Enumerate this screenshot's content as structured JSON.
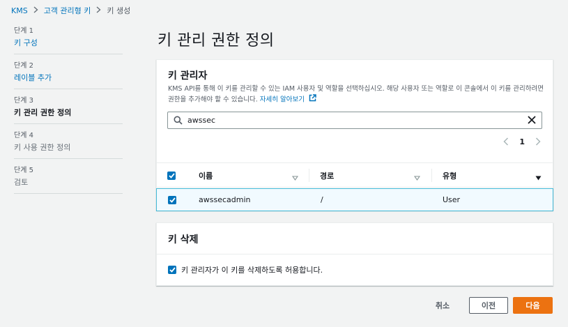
{
  "breadcrumb": {
    "items": [
      "KMS",
      "고객 관리형 키"
    ],
    "current": "키 생성"
  },
  "steps": [
    {
      "num": "단계 1",
      "label": "키 구성",
      "state": "link"
    },
    {
      "num": "단계 2",
      "label": "레이블 추가",
      "state": "link"
    },
    {
      "num": "단계 3",
      "label": "키 관리 권한 정의",
      "state": "active"
    },
    {
      "num": "단계 4",
      "label": "키 사용 권한 정의",
      "state": "disabled"
    },
    {
      "num": "단계 5",
      "label": "검토",
      "state": "disabled"
    }
  ],
  "page_title": "키 관리 권한 정의",
  "admins": {
    "title": "키 관리자",
    "description": "KMS API를 통해 이 키를 관리할 수 있는 IAM 사용자 및 역할을 선택하십시오. 해당 사용자 또는 역할로 이 콘솔에서 이 키를 관리하려면 권한을 추가해야 할 수 있습니다.",
    "learn_more": "자세히 알아보기",
    "search_value": "awssec",
    "page": "1",
    "columns": [
      "이름",
      "경로",
      "유형"
    ],
    "rows": [
      {
        "name": "awssecadmin",
        "path": "/",
        "type": "User",
        "selected": true
      }
    ]
  },
  "deletion": {
    "title": "키 삭제",
    "option_label": "키 관리자가 이 키를 삭제하도록 허용합니다.",
    "checked": true
  },
  "footer": {
    "cancel": "취소",
    "previous": "이전",
    "next": "다음"
  },
  "colors": {
    "link": "#0073bb",
    "primary_button": "#ec7211",
    "selected_row_border": "#44b9d6",
    "selected_row_bg": "#f1faff"
  }
}
